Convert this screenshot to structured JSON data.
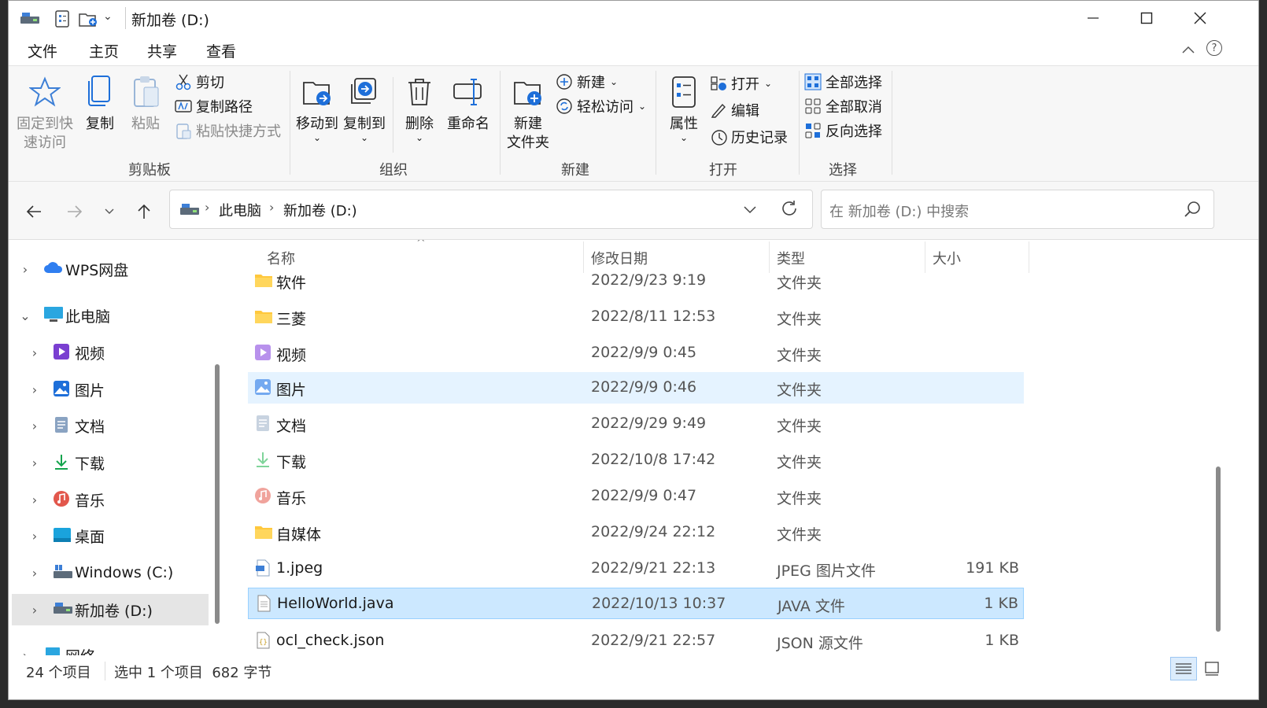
{
  "window": {
    "title": "新加卷 (D:)"
  },
  "tabs": [
    "文件",
    "主页",
    "共享",
    "查看"
  ],
  "ribbon": {
    "clipboard": {
      "pin_label_1": "固定到快",
      "pin_label_2": "速访问",
      "copy": "复制",
      "paste": "粘贴",
      "cut": "剪切",
      "copy_path": "复制路径",
      "paste_shortcut": "粘贴快捷方式",
      "group": "剪贴板"
    },
    "organize": {
      "move_to": "移动到",
      "copy_to": "复制到",
      "delete": "删除",
      "rename": "重命名",
      "group": "组织"
    },
    "new": {
      "new_folder_1": "新建",
      "new_folder_2": "文件夹",
      "new_item": "新建",
      "easy_access": "轻松访问",
      "group": "新建"
    },
    "open": {
      "properties": "属性",
      "open": "打开",
      "edit": "编辑",
      "history": "历史记录",
      "group": "打开"
    },
    "select": {
      "select_all": "全部选择",
      "select_none": "全部取消",
      "invert": "反向选择",
      "group": "选择"
    }
  },
  "address": {
    "crumbs": [
      "此电脑",
      "新加卷 (D:)"
    ],
    "search_placeholder": "在 新加卷 (D:) 中搜索"
  },
  "nav_tree": [
    {
      "label": "WPS网盘",
      "icon": "cloud-icon"
    },
    {
      "label": "此电脑",
      "icon": "computer-icon"
    },
    {
      "label": "视频",
      "icon": "video-icon"
    },
    {
      "label": "图片",
      "icon": "pictures-icon"
    },
    {
      "label": "文档",
      "icon": "documents-icon"
    },
    {
      "label": "下载",
      "icon": "download-icon"
    },
    {
      "label": "音乐",
      "icon": "music-icon"
    },
    {
      "label": "桌面",
      "icon": "desktop-icon"
    },
    {
      "label": "Windows  (C:)",
      "icon": "drive-icon"
    },
    {
      "label": "新加卷 (D:)",
      "icon": "drive-icon"
    },
    {
      "label": "网络",
      "icon": "network-icon"
    }
  ],
  "columns": {
    "name": "名称",
    "date": "修改日期",
    "type": "类型",
    "size": "大小"
  },
  "files": [
    {
      "name": "软件",
      "date": "2022/9/23 9:19",
      "type": "文件夹",
      "size": "",
      "icon": "folder-icon"
    },
    {
      "name": "三菱",
      "date": "2022/8/11 12:53",
      "type": "文件夹",
      "size": "",
      "icon": "folder-icon"
    },
    {
      "name": "视频",
      "date": "2022/9/9 0:45",
      "type": "文件夹",
      "size": "",
      "icon": "video-folder-icon"
    },
    {
      "name": "图片",
      "date": "2022/9/9 0:46",
      "type": "文件夹",
      "size": "",
      "icon": "pictures-folder-icon"
    },
    {
      "name": "文档",
      "date": "2022/9/29 9:49",
      "type": "文件夹",
      "size": "",
      "icon": "documents-folder-icon"
    },
    {
      "name": "下载",
      "date": "2022/10/8 17:42",
      "type": "文件夹",
      "size": "",
      "icon": "download-folder-icon"
    },
    {
      "name": "音乐",
      "date": "2022/9/9 0:47",
      "type": "文件夹",
      "size": "",
      "icon": "music-folder-icon"
    },
    {
      "name": "自媒体",
      "date": "2022/9/24 22:12",
      "type": "文件夹",
      "size": "",
      "icon": "folder-icon"
    },
    {
      "name": "1.jpeg",
      "date": "2022/9/21 22:13",
      "type": "JPEG 图片文件",
      "size": "191 KB",
      "icon": "image-file-icon"
    },
    {
      "name": "HelloWorld.java",
      "date": "2022/10/13 10:37",
      "type": "JAVA 文件",
      "size": "1 KB",
      "icon": "text-file-icon"
    },
    {
      "name": "ocl_check.json",
      "date": "2022/9/21 22:57",
      "type": "JSON 源文件",
      "size": "1 KB",
      "icon": "json-file-icon"
    }
  ],
  "status": {
    "count": "24 个项目",
    "selection": "选中 1 个项目  682 字节"
  },
  "colors": {
    "accent": "#1e6fd9",
    "selected_row": "#cce8ff",
    "hover_row": "#e5f3ff",
    "folder": "#ffc83d"
  }
}
